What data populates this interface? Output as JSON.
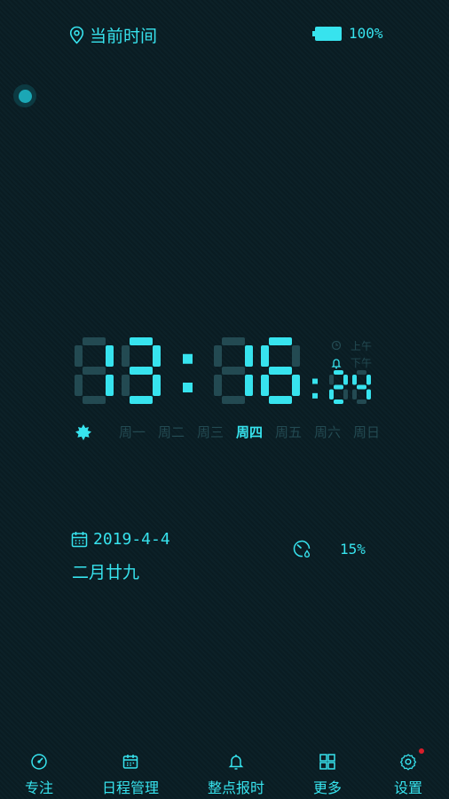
{
  "header": {
    "location_label": "当前时间",
    "battery_text": "100%",
    "battery_level": 1.0
  },
  "clock": {
    "hours": "13",
    "minutes": "16",
    "seconds": "24",
    "separator": ":",
    "am_label": "上午",
    "pm_label": "下午",
    "active_period": "pm"
  },
  "weekdays": {
    "items": [
      "周一",
      "周二",
      "周三",
      "周四",
      "周五",
      "周六",
      "周日"
    ],
    "active_index": 3
  },
  "date": {
    "solar": "2019-4-4",
    "lunar": "二月廿九"
  },
  "humidity": {
    "value": "15%"
  },
  "nav": {
    "items": [
      {
        "label": "专注",
        "icon": "focus-icon"
      },
      {
        "label": "日程管理",
        "icon": "calendar-icon"
      },
      {
        "label": "整点报时",
        "icon": "bell-icon"
      },
      {
        "label": "更多",
        "icon": "grid-icon"
      },
      {
        "label": "设置",
        "icon": "gear-icon"
      }
    ]
  },
  "colors": {
    "accent": "#37e3ee",
    "dim": "#234a52",
    "background": "#0b1e24",
    "badge": "#d81e2a"
  }
}
